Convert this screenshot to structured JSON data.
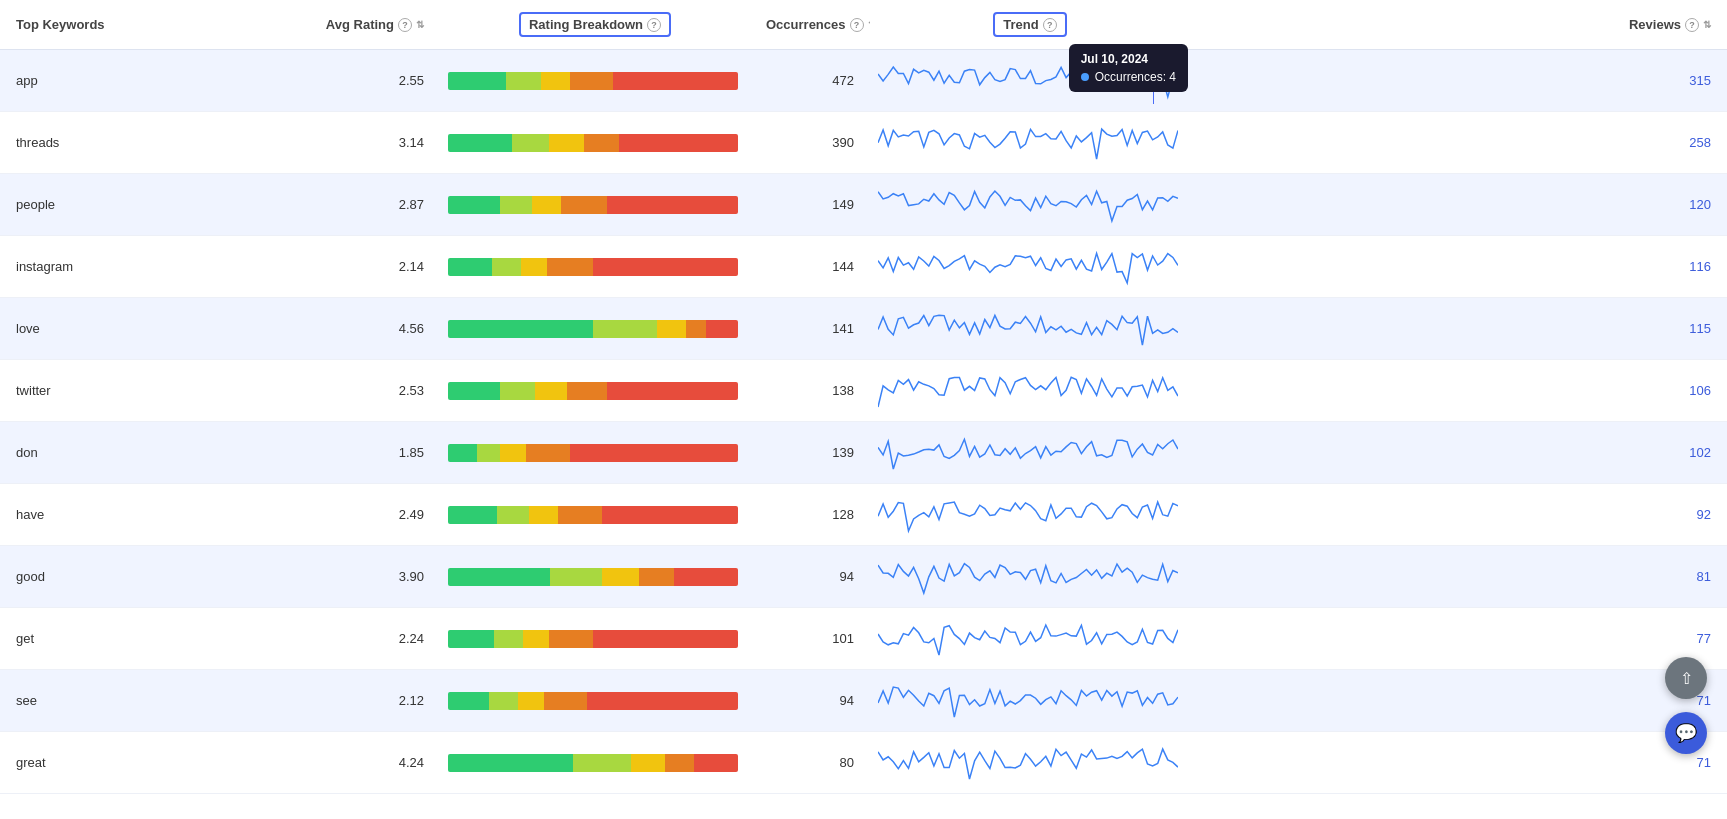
{
  "colors": {
    "accent": "#4a6cf7",
    "tooltip_bg": "#1a1a2e",
    "odd_row": "#f0f4ff",
    "even_row": "#ffffff",
    "link": "#3b5bdb"
  },
  "header": {
    "col_keyword": "Top Keywords",
    "col_avg_rating": "Avg Rating",
    "col_rating_breakdown": "Rating Breakdown",
    "col_occurrences": "Occurrences",
    "col_trend": "Trend",
    "col_reviews": "Reviews"
  },
  "tooltip": {
    "date": "Jul 10, 2024",
    "label": "Occurrences:",
    "value": "4"
  },
  "rows": [
    {
      "keyword": "app",
      "avg_rating": "2.55",
      "occurrences": "472",
      "reviews": "315",
      "bar_segments": [
        {
          "color": "#2ecc71",
          "width": 20
        },
        {
          "color": "#a8d840",
          "width": 12
        },
        {
          "color": "#f1c40f",
          "width": 10
        },
        {
          "color": "#e67e22",
          "width": 15
        },
        {
          "color": "#e74c3c",
          "width": 43
        }
      ]
    },
    {
      "keyword": "threads",
      "avg_rating": "3.14",
      "occurrences": "390",
      "reviews": "258",
      "bar_segments": [
        {
          "color": "#2ecc71",
          "width": 22
        },
        {
          "color": "#a8d840",
          "width": 13
        },
        {
          "color": "#f1c40f",
          "width": 12
        },
        {
          "color": "#e67e22",
          "width": 12
        },
        {
          "color": "#e74c3c",
          "width": 41
        }
      ]
    },
    {
      "keyword": "people",
      "avg_rating": "2.87",
      "occurrences": "149",
      "reviews": "120",
      "bar_segments": [
        {
          "color": "#2ecc71",
          "width": 18
        },
        {
          "color": "#a8d840",
          "width": 11
        },
        {
          "color": "#f1c40f",
          "width": 10
        },
        {
          "color": "#e67e22",
          "width": 16
        },
        {
          "color": "#e74c3c",
          "width": 45
        }
      ]
    },
    {
      "keyword": "instagram",
      "avg_rating": "2.14",
      "occurrences": "144",
      "reviews": "116",
      "bar_segments": [
        {
          "color": "#2ecc71",
          "width": 15
        },
        {
          "color": "#a8d840",
          "width": 10
        },
        {
          "color": "#f1c40f",
          "width": 9
        },
        {
          "color": "#e67e22",
          "width": 16
        },
        {
          "color": "#e74c3c",
          "width": 50
        }
      ]
    },
    {
      "keyword": "love",
      "avg_rating": "4.56",
      "occurrences": "141",
      "reviews": "115",
      "bar_segments": [
        {
          "color": "#2ecc71",
          "width": 50
        },
        {
          "color": "#a8d840",
          "width": 22
        },
        {
          "color": "#f1c40f",
          "width": 10
        },
        {
          "color": "#e67e22",
          "width": 7
        },
        {
          "color": "#e74c3c",
          "width": 11
        }
      ]
    },
    {
      "keyword": "twitter",
      "avg_rating": "2.53",
      "occurrences": "138",
      "reviews": "106",
      "bar_segments": [
        {
          "color": "#2ecc71",
          "width": 18
        },
        {
          "color": "#a8d840",
          "width": 12
        },
        {
          "color": "#f1c40f",
          "width": 11
        },
        {
          "color": "#e67e22",
          "width": 14
        },
        {
          "color": "#e74c3c",
          "width": 45
        }
      ]
    },
    {
      "keyword": "don",
      "avg_rating": "1.85",
      "occurrences": "139",
      "reviews": "102",
      "bar_segments": [
        {
          "color": "#2ecc71",
          "width": 10
        },
        {
          "color": "#a8d840",
          "width": 8
        },
        {
          "color": "#f1c40f",
          "width": 9
        },
        {
          "color": "#e67e22",
          "width": 15
        },
        {
          "color": "#e74c3c",
          "width": 58
        }
      ]
    },
    {
      "keyword": "have",
      "avg_rating": "2.49",
      "occurrences": "128",
      "reviews": "92",
      "bar_segments": [
        {
          "color": "#2ecc71",
          "width": 17
        },
        {
          "color": "#a8d840",
          "width": 11
        },
        {
          "color": "#f1c40f",
          "width": 10
        },
        {
          "color": "#e67e22",
          "width": 15
        },
        {
          "color": "#e74c3c",
          "width": 47
        }
      ]
    },
    {
      "keyword": "good",
      "avg_rating": "3.90",
      "occurrences": "94",
      "reviews": "81",
      "bar_segments": [
        {
          "color": "#2ecc71",
          "width": 35
        },
        {
          "color": "#a8d840",
          "width": 18
        },
        {
          "color": "#f1c40f",
          "width": 13
        },
        {
          "color": "#e67e22",
          "width": 12
        },
        {
          "color": "#e74c3c",
          "width": 22
        }
      ]
    },
    {
      "keyword": "get",
      "avg_rating": "2.24",
      "occurrences": "101",
      "reviews": "77",
      "bar_segments": [
        {
          "color": "#2ecc71",
          "width": 16
        },
        {
          "color": "#a8d840",
          "width": 10
        },
        {
          "color": "#f1c40f",
          "width": 9
        },
        {
          "color": "#e67e22",
          "width": 15
        },
        {
          "color": "#e74c3c",
          "width": 50
        }
      ]
    },
    {
      "keyword": "see",
      "avg_rating": "2.12",
      "occurrences": "94",
      "reviews": "71",
      "bar_segments": [
        {
          "color": "#2ecc71",
          "width": 14
        },
        {
          "color": "#a8d840",
          "width": 10
        },
        {
          "color": "#f1c40f",
          "width": 9
        },
        {
          "color": "#e67e22",
          "width": 15
        },
        {
          "color": "#e74c3c",
          "width": 52
        }
      ]
    },
    {
      "keyword": "great",
      "avg_rating": "4.24",
      "occurrences": "80",
      "reviews": "71",
      "bar_segments": [
        {
          "color": "#2ecc71",
          "width": 43
        },
        {
          "color": "#a8d840",
          "width": 20
        },
        {
          "color": "#f1c40f",
          "width": 12
        },
        {
          "color": "#e67e22",
          "width": 10
        },
        {
          "color": "#e74c3c",
          "width": 15
        }
      ]
    }
  ]
}
